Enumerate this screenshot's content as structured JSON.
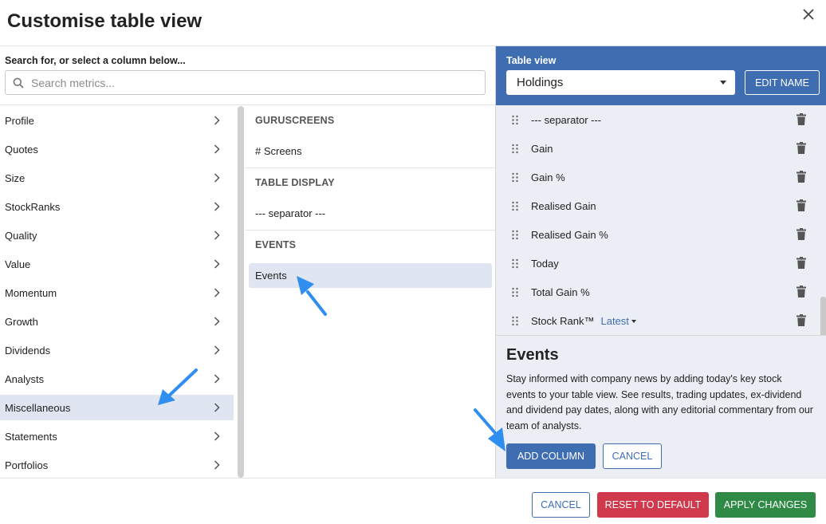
{
  "dialog": {
    "title": "Customise table view"
  },
  "search": {
    "label": "Search for, or select a column below...",
    "placeholder": "Search metrics...",
    "value": ""
  },
  "categories": [
    {
      "label": "Profile"
    },
    {
      "label": "Quotes"
    },
    {
      "label": "Size"
    },
    {
      "label": "StockRanks"
    },
    {
      "label": "Quality"
    },
    {
      "label": "Value"
    },
    {
      "label": "Momentum"
    },
    {
      "label": "Growth"
    },
    {
      "label": "Dividends"
    },
    {
      "label": "Analysts"
    },
    {
      "label": "Miscellaneous",
      "selected": true
    },
    {
      "label": "Statements"
    },
    {
      "label": "Portfolios"
    }
  ],
  "metrics": {
    "sections": [
      {
        "header": "GURUSCREENS",
        "items": [
          "# Screens"
        ]
      },
      {
        "header": "TABLE DISPLAY",
        "items": [
          "--- separator ---"
        ]
      },
      {
        "header": "EVENTS",
        "items": [
          "Events"
        ]
      }
    ],
    "selected_item": "Events"
  },
  "table_view": {
    "label": "Table view",
    "selected": "Holdings",
    "edit_name_label": "EDIT NAME",
    "columns": [
      {
        "name": "--- separator ---"
      },
      {
        "name": "Gain"
      },
      {
        "name": "Gain %"
      },
      {
        "name": "Realised Gain"
      },
      {
        "name": "Realised Gain %"
      },
      {
        "name": "Today"
      },
      {
        "name": "Total Gain %"
      },
      {
        "name": "Stock Rank™",
        "option": "Latest"
      }
    ]
  },
  "detail": {
    "title": "Events",
    "description": "Stay informed with company news by adding today's key stock events to your table view. See results, trading updates, ex-dividend and dividend pay dates, along with any editorial commentary from our team of analysts.",
    "add_label": "ADD COLUMN",
    "cancel_label": "CANCEL"
  },
  "footer": {
    "cancel_label": "CANCEL",
    "reset_label": "RESET TO DEFAULT",
    "apply_label": "APPLY CHANGES"
  },
  "colors": {
    "primary": "#3e6db2",
    "danger": "#d0394c",
    "success": "#2e8a44",
    "selected_bg": "#dfe6f2",
    "annotation_arrow": "#2f8ef0"
  },
  "icons": {
    "close": "close-icon",
    "search": "search-icon",
    "chevron": "chevron-right-icon",
    "drag": "drag-handle-icon",
    "trash": "trash-icon"
  }
}
